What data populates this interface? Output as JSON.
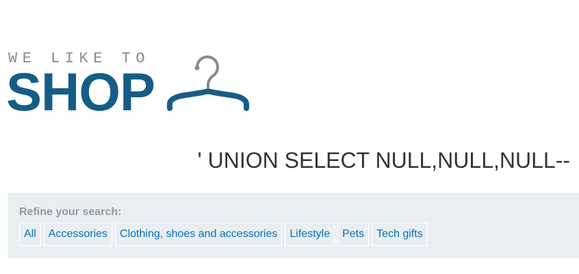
{
  "logo": {
    "tagline": "WE LIKE TO",
    "word": "SHOP",
    "icon": "hanger-icon",
    "colors": {
      "tagline": "#8a8a8a",
      "word": "#155d86"
    }
  },
  "search": {
    "heading": "' UNION SELECT NULL,NULL,NULL--"
  },
  "filters": {
    "label": "Refine your search:",
    "items": [
      {
        "label": "All"
      },
      {
        "label": "Accessories"
      },
      {
        "label": "Clothing, shoes and accessories"
      },
      {
        "label": "Lifestyle"
      },
      {
        "label": "Pets"
      },
      {
        "label": "Tech gifts"
      }
    ],
    "colors": {
      "panel": "#e9eef1",
      "link": "#0071bc"
    }
  }
}
